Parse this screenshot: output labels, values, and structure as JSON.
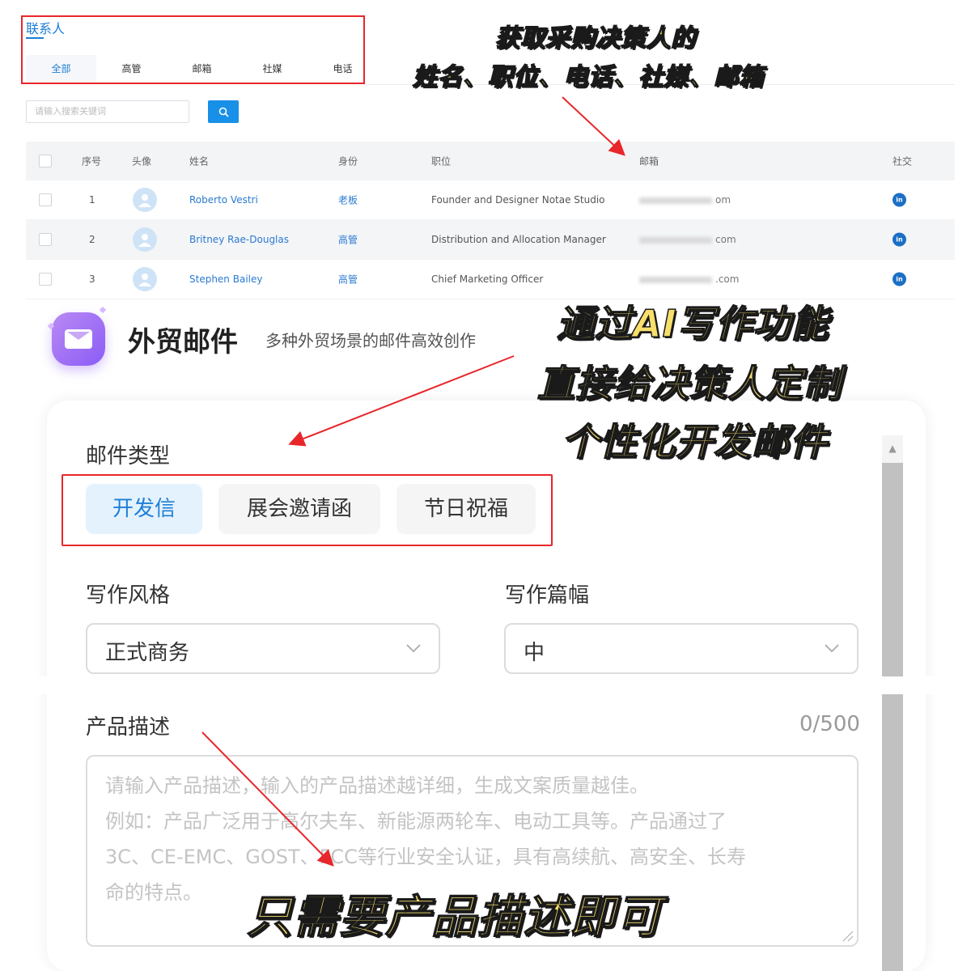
{
  "contacts": {
    "title": "联系人",
    "filter_tabs": [
      {
        "label": "全部",
        "active": true
      },
      {
        "label": "高管",
        "active": false
      },
      {
        "label": "邮箱",
        "active": false
      },
      {
        "label": "社媒",
        "active": false
      },
      {
        "label": "电话",
        "active": false
      }
    ],
    "search": {
      "placeholder": "请输入搜索关键词"
    },
    "table": {
      "headers": [
        "序号",
        "头像",
        "姓名",
        "身份",
        "职位",
        "邮箱",
        "社交"
      ],
      "rows": [
        {
          "index": "1",
          "name": "Roberto Vestri",
          "role": "老板",
          "title": "Founder and Designer Notae Studio",
          "email_visible": "om",
          "social": "in"
        },
        {
          "index": "2",
          "name": "Britney Rae-Douglas",
          "role": "高管",
          "title": "Distribution and Allocation Manager",
          "email_visible": "com",
          "social": "in"
        },
        {
          "index": "3",
          "name": "Stephen Bailey",
          "role": "高管",
          "title": "Chief Marketing Officer",
          "email_visible": ".com",
          "social": "in"
        }
      ]
    }
  },
  "callouts": {
    "top_line1": "获取采购决策人的",
    "top_line2": "姓名、职位、电话、社媒、邮箱",
    "mid_line1": "通过AI写作功能",
    "mid_line2": "直接给决策人定制",
    "mid_line3": "个性化开发邮件",
    "bottom": "只需要产品描述即可"
  },
  "email_module": {
    "title": "外贸邮件",
    "subtitle": "多种外贸场景的邮件高效创作",
    "type_label": "邮件类型",
    "types": [
      {
        "label": "开发信",
        "active": true
      },
      {
        "label": "展会邀请函",
        "active": false
      },
      {
        "label": "节日祝福",
        "active": false
      }
    ],
    "style_label": "写作风格",
    "style_value": "正式商务",
    "length_label": "写作篇幅",
    "length_value": "中",
    "desc_label": "产品描述",
    "desc_counter": "0/500",
    "desc_placeholder_lines": [
      "请输入产品描述，输入的产品描述越详细，生成文案质量越佳。",
      "例如：产品广泛用于高尔夫车、新能源两轮车、电动工具等。产品通过了",
      "3C、CE-EMC、GOST、FCC等行业安全认证，具有高续航、高安全、长寿",
      "命的特点。"
    ]
  },
  "colors": {
    "accent": "#1c7cd6",
    "highlight_red": "#e8262b",
    "callout_fill": "#f7df6c",
    "active_type_bg": "#e4f2fd"
  }
}
